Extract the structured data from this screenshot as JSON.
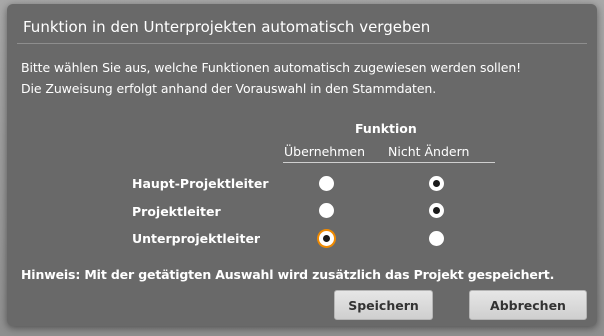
{
  "dialog": {
    "title": "Funktion in den Unterprojekten automatisch vergeben",
    "description_line1": "Bitte wählen Sie aus, welche Funktionen automatisch zugewiesen werden sollen!",
    "description_line2": "Die Zuweisung erfolgt anhand der Vorauswahl in den Stammdaten.",
    "group_header": "Funktion",
    "columns": [
      "Übernehmen",
      "Nicht Ändern"
    ],
    "rows": [
      {
        "label": "Haupt-Projektleiter",
        "selected": "Nicht Ändern"
      },
      {
        "label": "Projektleiter",
        "selected": "Nicht Ändern"
      },
      {
        "label": "Unterprojektleiter",
        "selected": "Übernehmen",
        "focused": true
      }
    ],
    "hint": "Hinweis: Mit der getätigten Auswahl wird zusätzlich das Projekt gespeichert.",
    "buttons": {
      "save_label": "Speichern",
      "cancel_label": "Abbrechen"
    }
  },
  "colors": {
    "dialog_background": "#696969",
    "focus_ring": "#f08a00",
    "button_background": "#dcdcdc"
  }
}
